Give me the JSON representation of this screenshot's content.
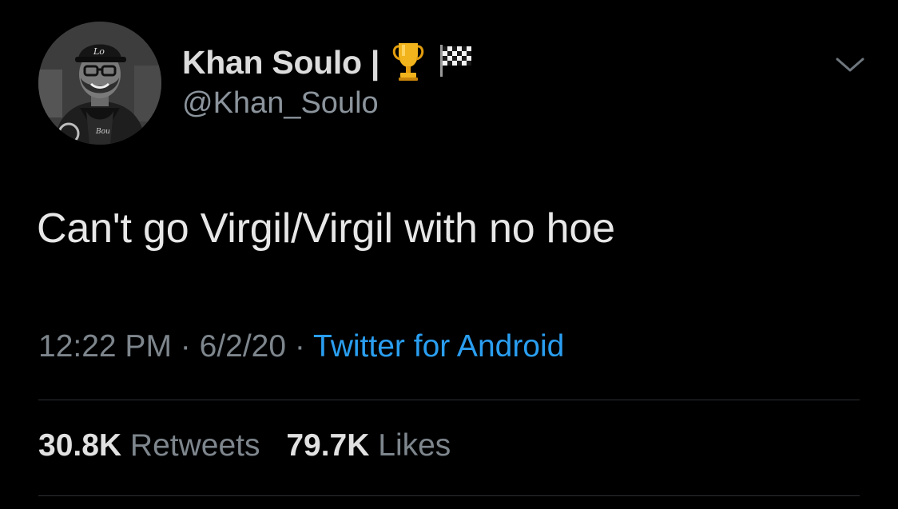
{
  "author": {
    "display_name": "Khan Soulo |",
    "handle": "@Khan_Soulo",
    "name_emojis": [
      "trophy-icon",
      "checkered-flag-icon"
    ]
  },
  "tweet": {
    "text": "Can't go Virgil/Virgil with no hoe",
    "time": "12:22 PM",
    "separator": "·",
    "date": "6/2/20",
    "source": "Twitter for Android"
  },
  "stats": {
    "retweets_count": "30.8K",
    "retweets_label": "Retweets",
    "likes_count": "79.7K",
    "likes_label": "Likes"
  },
  "colors": {
    "background": "#000000",
    "link": "#2a9ef0",
    "secondary_text": "#7e868d"
  }
}
